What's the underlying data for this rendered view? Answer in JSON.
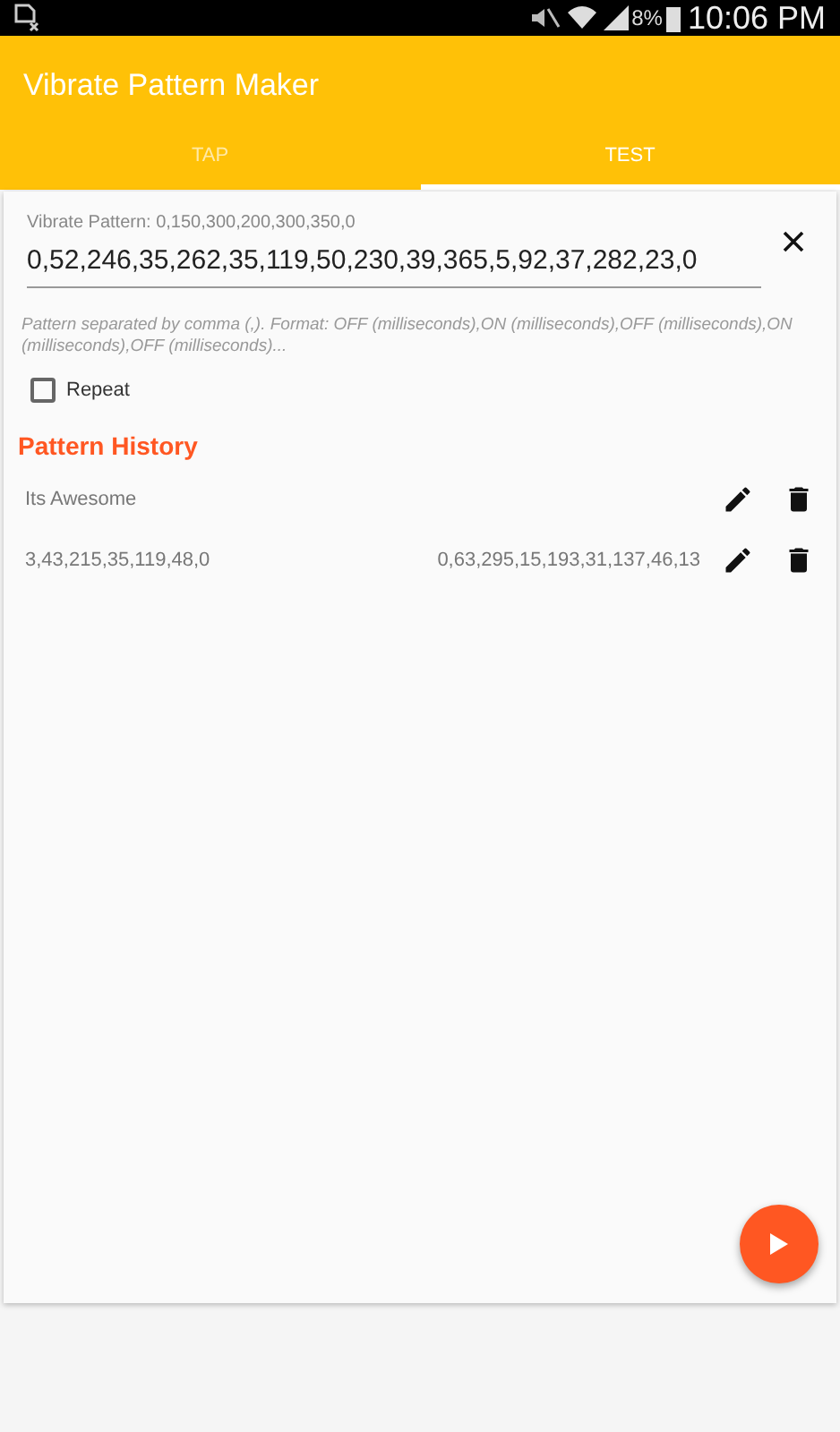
{
  "status_bar": {
    "battery": "8%",
    "time": "10:06 PM"
  },
  "app_bar": {
    "title": "Vibrate Pattern Maker"
  },
  "tabs": [
    {
      "label": "TAP",
      "selected": false
    },
    {
      "label": "TEST",
      "selected": true
    }
  ],
  "pattern_field": {
    "label": "Vibrate Pattern: 0,150,300,200,300,350,0",
    "value": "0,52,246,35,262,35,119,50,230,39,365,5,92,37,282,23,0",
    "helper": "Pattern separated by comma (,). Format: OFF (milliseconds),ON (milliseconds),OFF (milliseconds),ON (milliseconds),OFF (milliseconds)..."
  },
  "repeat": {
    "label": "Repeat",
    "checked": false
  },
  "history": {
    "title": "Pattern History",
    "items": [
      {
        "texts": [
          "Its Awesome"
        ]
      },
      {
        "texts": [
          "3,43,215,35,119,48,0",
          "0,63,295,15,193,31,137,46,13"
        ]
      }
    ]
  }
}
